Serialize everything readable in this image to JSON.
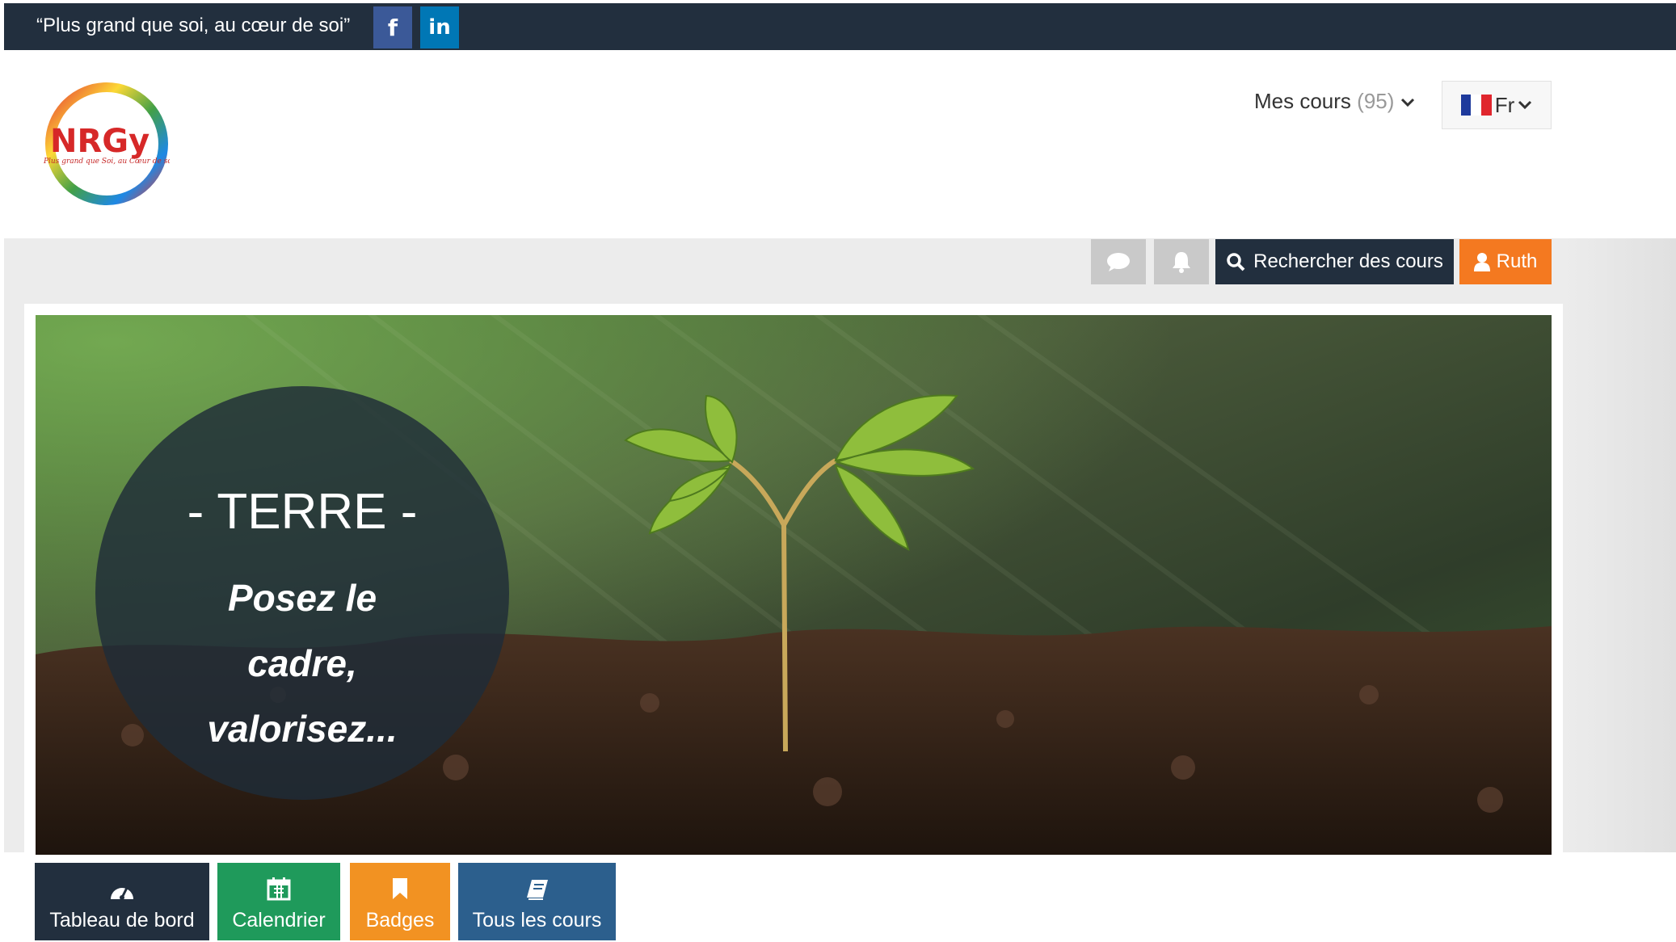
{
  "topbar": {
    "tagline": "“Plus grand que soi, au cœur de soi”",
    "facebook_label": "f",
    "linkedin_label": "in"
  },
  "header": {
    "logo_text": "NRGy",
    "logo_subtext": "Plus grand que Soi, au Cœur de soi",
    "my_courses_label": "Mes cours",
    "my_courses_count": "(95)",
    "language_label": "Fr"
  },
  "toolbar": {
    "search_label": "Rechercher des cours",
    "user_label": "Ruth"
  },
  "hero": {
    "title": "- TERRE -",
    "subtitle_lines": [
      "Posez le",
      "cadre,",
      "valorisez..."
    ]
  },
  "tiles": [
    {
      "label": "Tableau de bord",
      "icon": "dashboard-icon"
    },
    {
      "label": "Calendrier",
      "icon": "calendar-icon"
    },
    {
      "label": "Badges",
      "icon": "bookmark-icon"
    },
    {
      "label": "Tous les cours",
      "icon": "book-icon"
    }
  ],
  "colors": {
    "navy": "#222f3e",
    "orange": "#f47920",
    "green": "#1f9a5b",
    "badge_orange": "#f29222",
    "blue": "#2c5f8d"
  }
}
